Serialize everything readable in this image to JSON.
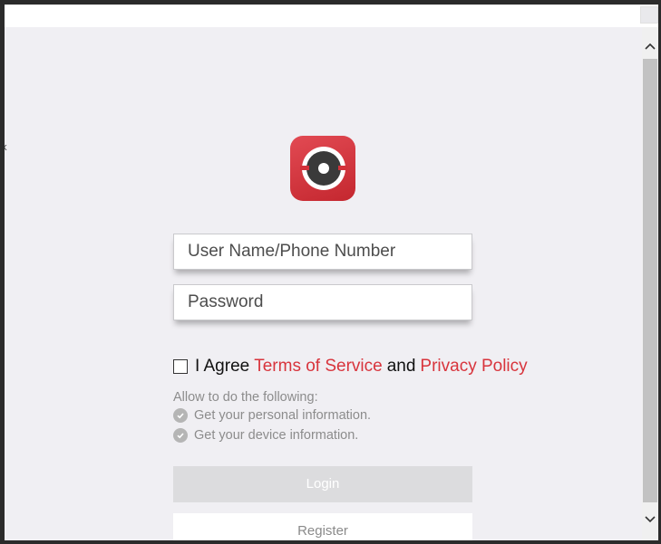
{
  "window": {
    "edge_text": "k"
  },
  "login": {
    "logo_icon": "camera-lens-icon",
    "brand_color": "#d3313a",
    "username_placeholder": "User Name/Phone Number",
    "password_placeholder": "Password",
    "agree_prefix": "I Agree",
    "terms_link": "Terms of Service",
    "agree_and": "and",
    "privacy_link": "Privacy Policy",
    "permissions_title": "Allow to do the following:",
    "permissions": [
      "Get your personal information.",
      "Get your device information."
    ],
    "login_label": "Login",
    "register_label": "Register"
  }
}
